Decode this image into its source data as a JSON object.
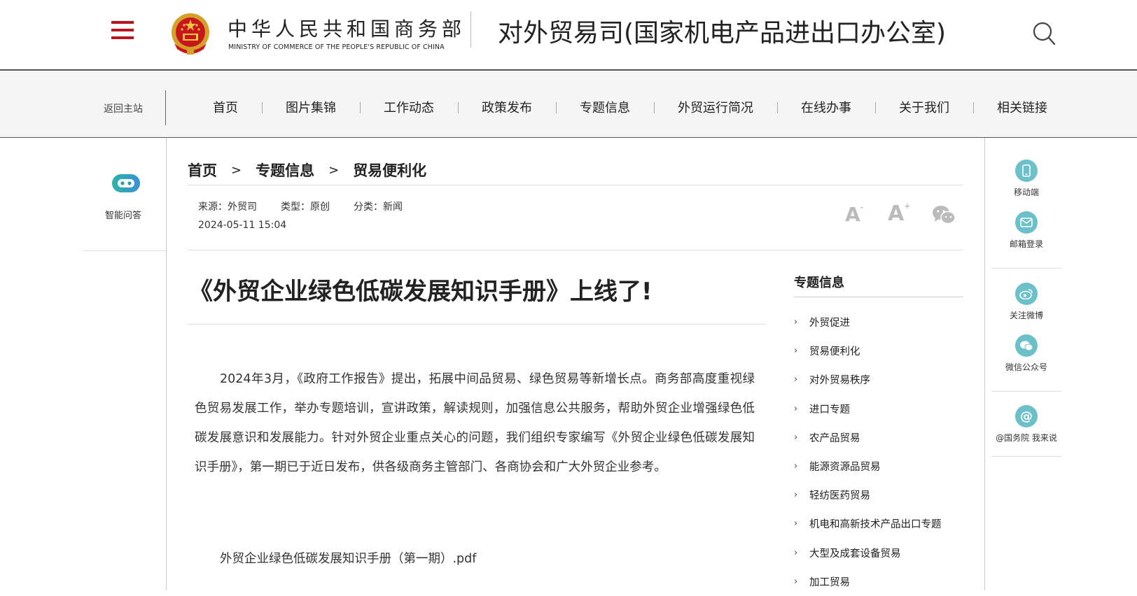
{
  "header": {
    "ministry_cn": "中华人民共和国商务部",
    "ministry_en": "MINISTRY OF COMMERCE OF THE PEOPLE'S REPUBLIC OF CHINA",
    "dept_title": "对外贸易司(国家机电产品进出口办公室)"
  },
  "nav": {
    "home": "返回主站",
    "items": [
      "首页",
      "图片集锦",
      "工作动态",
      "政策发布",
      "专题信息",
      "外贸运行简况",
      "在线办事",
      "关于我们",
      "相关链接"
    ]
  },
  "left": {
    "robot_label": "智能问答"
  },
  "breadcrumb": [
    "首页",
    ">",
    "专题信息",
    ">",
    "贸易便利化"
  ],
  "meta": {
    "source": "来源：外贸司",
    "type": "类型：原创",
    "category": "分类：新闻",
    "date": "2024-05-11 15:04"
  },
  "tools": {
    "font_small": "A",
    "font_large": "A",
    "small_sup": "-",
    "large_sup": "+"
  },
  "article": {
    "title": "《外贸企业绿色低碳发展知识手册》上线了!",
    "body": "2024年3月，《政府工作报告》提出，拓展中间品贸易、绿色贸易等新增长点。商务部高度重视绿色贸易发展工作，举办专题培训，宣讲政策，解读规则，加强信息公共服务，帮助外贸企业增强绿色低碳发展意识和发展能力。针对外贸企业重点关心的问题，我们组织专家编写《外贸企业绿色低碳发展知识手册》，第一期已于近日发布，供各级商务主管部门、各商协会和广大外贸企业参考。",
    "attachment": "外贸企业绿色低碳发展知识手册（第一期）.pdf"
  },
  "topics": {
    "title": "专题信息",
    "items": [
      "外贸促进",
      "贸易便利化",
      "对外贸易秩序",
      "进口专题",
      "农产品贸易",
      "能源资源品贸易",
      "轻纺医药贸易",
      "机电和高新技术产品出口专题",
      "大型及成套设备贸易",
      "加工贸易"
    ]
  },
  "rail": {
    "mobile": "移动端",
    "email": "邮箱登录",
    "weibo": "关注微博",
    "wechat": "微信公众号",
    "gov": "@国务院 我来说"
  },
  "colors": {
    "brand_red": "#b3191e",
    "rail_teal": "#6cc0c9"
  }
}
